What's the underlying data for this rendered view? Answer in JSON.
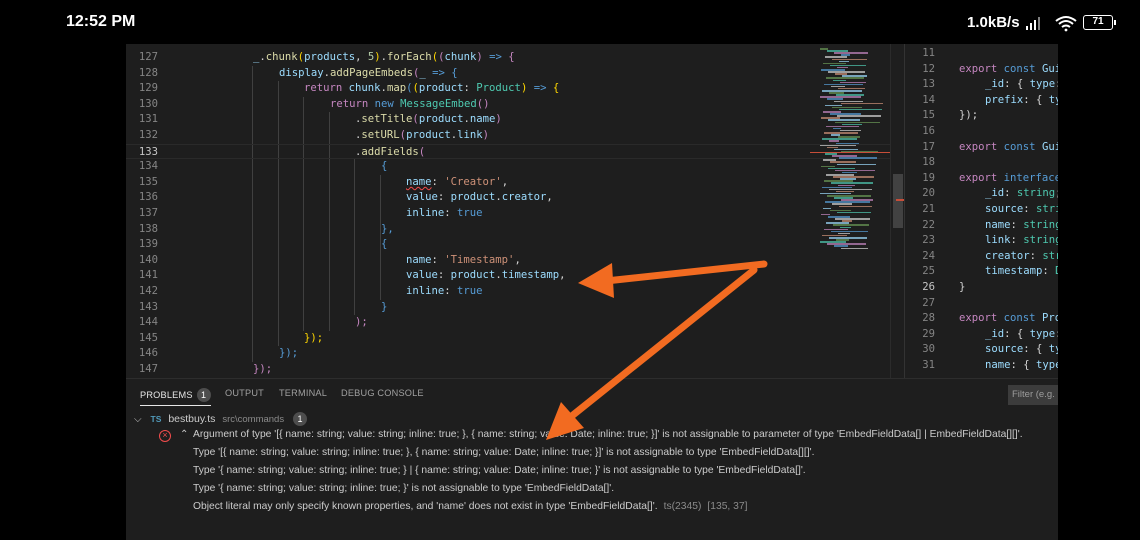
{
  "status_bar": {
    "time": "12:52 PM",
    "network_speed": "1.0kB/s",
    "battery_level": "71",
    "signal_icon": "cellular-signal-icon",
    "wifi_icon": "wifi-icon"
  },
  "editor": {
    "current_line": "133",
    "lines": [
      {
        "ln": "127",
        "tokens": [
          [
            "_",
            "t-var"
          ],
          [
            ".",
            "t-plain"
          ],
          [
            "chunk",
            "t-fn"
          ],
          [
            "(",
            "t-punct"
          ],
          [
            "products",
            "t-var"
          ],
          [
            ", ",
            "t-plain"
          ],
          [
            "5",
            "t-num"
          ],
          [
            ")",
            "t-punct"
          ],
          [
            ".",
            "t-plain"
          ],
          [
            "forEach",
            "t-fn"
          ],
          [
            "(",
            "t-punct"
          ],
          [
            "(",
            "t-kw"
          ],
          [
            "chunk",
            "t-var"
          ],
          [
            ")",
            "t-kw"
          ],
          [
            " => ",
            "t-dec"
          ],
          [
            "{",
            "t-kw"
          ]
        ]
      },
      {
        "ln": "128",
        "tokens": [
          [
            "display",
            "t-var"
          ],
          [
            ".",
            "t-plain"
          ],
          [
            "addPageEmbeds",
            "t-fn"
          ],
          [
            "(",
            "t-kw"
          ],
          [
            "_",
            "t-var"
          ],
          [
            " => ",
            "t-dec"
          ],
          [
            "{",
            "t-dec"
          ]
        ]
      },
      {
        "ln": "129",
        "tokens": [
          [
            "return ",
            "t-kw"
          ],
          [
            "chunk",
            "t-var"
          ],
          [
            ".",
            "t-plain"
          ],
          [
            "map",
            "t-fn"
          ],
          [
            "(",
            "t-dec"
          ],
          [
            "(",
            "t-punct"
          ],
          [
            "product",
            "t-var"
          ],
          [
            ": ",
            "t-plain"
          ],
          [
            "Product",
            "t-type"
          ],
          [
            ")",
            "t-punct"
          ],
          [
            " => ",
            "t-dec"
          ],
          [
            "{",
            "t-punct"
          ]
        ]
      },
      {
        "ln": "130",
        "tokens": [
          [
            "return ",
            "t-kw"
          ],
          [
            "new ",
            "t-dec"
          ],
          [
            "MessageEmbed",
            "t-type"
          ],
          [
            "()",
            "t-kw"
          ]
        ]
      },
      {
        "ln": "131",
        "tokens": [
          [
            ".",
            "t-plain"
          ],
          [
            "setTitle",
            "t-fn"
          ],
          [
            "(",
            "t-kw"
          ],
          [
            "product",
            "t-var"
          ],
          [
            ".",
            "t-plain"
          ],
          [
            "name",
            "t-var"
          ],
          [
            ")",
            "t-kw"
          ]
        ]
      },
      {
        "ln": "132",
        "tokens": [
          [
            ".",
            "t-plain"
          ],
          [
            "setURL",
            "t-fn"
          ],
          [
            "(",
            "t-kw"
          ],
          [
            "product",
            "t-var"
          ],
          [
            ".",
            "t-plain"
          ],
          [
            "link",
            "t-var"
          ],
          [
            ")",
            "t-kw"
          ]
        ]
      },
      {
        "ln": "133",
        "tokens": [
          [
            ".",
            "t-plain"
          ],
          [
            "addFields",
            "t-fn"
          ],
          [
            "(",
            "t-kw"
          ]
        ]
      },
      {
        "ln": "134",
        "tokens": [
          [
            "{",
            "t-dec"
          ]
        ]
      },
      {
        "ln": "135",
        "tokens": [
          [
            "name",
            "t-var t-err"
          ],
          [
            ": ",
            "t-plain"
          ],
          [
            "'Creator'",
            "t-str"
          ],
          [
            ",",
            "t-plain"
          ]
        ]
      },
      {
        "ln": "136",
        "tokens": [
          [
            "value",
            "t-var"
          ],
          [
            ": ",
            "t-plain"
          ],
          [
            "product",
            "t-var"
          ],
          [
            ".",
            "t-plain"
          ],
          [
            "creator",
            "t-var"
          ],
          [
            ",",
            "t-plain"
          ]
        ]
      },
      {
        "ln": "137",
        "tokens": [
          [
            "inline",
            "t-var"
          ],
          [
            ": ",
            "t-plain"
          ],
          [
            "true",
            "t-dec"
          ]
        ]
      },
      {
        "ln": "138",
        "tokens": [
          [
            "},",
            "t-dec"
          ]
        ]
      },
      {
        "ln": "139",
        "tokens": [
          [
            "{",
            "t-dec"
          ]
        ]
      },
      {
        "ln": "140",
        "tokens": [
          [
            "name",
            "t-var"
          ],
          [
            ": ",
            "t-plain"
          ],
          [
            "'Timestamp'",
            "t-str"
          ],
          [
            ",",
            "t-plain"
          ]
        ]
      },
      {
        "ln": "141",
        "tokens": [
          [
            "value",
            "t-var"
          ],
          [
            ": ",
            "t-plain"
          ],
          [
            "product",
            "t-var"
          ],
          [
            ".",
            "t-plain"
          ],
          [
            "timestamp",
            "t-var"
          ],
          [
            ",",
            "t-plain"
          ]
        ]
      },
      {
        "ln": "142",
        "tokens": [
          [
            "inline",
            "t-var"
          ],
          [
            ": ",
            "t-plain"
          ],
          [
            "true",
            "t-dec"
          ]
        ]
      },
      {
        "ln": "143",
        "tokens": [
          [
            "}",
            "t-dec"
          ]
        ]
      },
      {
        "ln": "144",
        "tokens": [
          [
            ");",
            "t-kw"
          ]
        ]
      },
      {
        "ln": "145",
        "tokens": [
          [
            "});",
            "t-punct"
          ]
        ]
      },
      {
        "ln": "146",
        "tokens": [
          [
            "});",
            "t-dec"
          ]
        ]
      },
      {
        "ln": "147",
        "tokens": [
          [
            "});",
            "t-kw"
          ]
        ]
      }
    ]
  },
  "split_editor": {
    "lines": [
      {
        "ln": "11",
        "tokens": []
      },
      {
        "ln": "12",
        "tokens": [
          [
            "export ",
            "t-kw"
          ],
          [
            "const ",
            "t-dec"
          ],
          [
            "Gui",
            "t-var"
          ]
        ]
      },
      {
        "ln": "13",
        "tokens": [
          [
            "_id",
            "t-var"
          ],
          [
            ": { ",
            "t-plain"
          ],
          [
            "type",
            "t-var"
          ],
          [
            ":",
            "t-plain"
          ]
        ]
      },
      {
        "ln": "14",
        "tokens": [
          [
            "prefix",
            "t-var"
          ],
          [
            ": { ",
            "t-plain"
          ],
          [
            "ty",
            "t-var"
          ]
        ]
      },
      {
        "ln": "15",
        "tokens": [
          [
            "});",
            "t-plain"
          ]
        ]
      },
      {
        "ln": "16",
        "tokens": []
      },
      {
        "ln": "17",
        "tokens": [
          [
            "export ",
            "t-kw"
          ],
          [
            "const ",
            "t-dec"
          ],
          [
            "Gui",
            "t-var"
          ]
        ]
      },
      {
        "ln": "18",
        "tokens": []
      },
      {
        "ln": "19",
        "tokens": [
          [
            "export ",
            "t-kw"
          ],
          [
            "interface",
            "t-dec"
          ]
        ]
      },
      {
        "ln": "20",
        "tokens": [
          [
            "_id",
            "t-var"
          ],
          [
            ": ",
            "t-plain"
          ],
          [
            "string",
            "t-type"
          ],
          [
            ";",
            "t-plain"
          ]
        ]
      },
      {
        "ln": "21",
        "tokens": [
          [
            "source",
            "t-var"
          ],
          [
            ": ",
            "t-plain"
          ],
          [
            "stri",
            "t-type"
          ]
        ]
      },
      {
        "ln": "22",
        "tokens": [
          [
            "name",
            "t-var"
          ],
          [
            ": ",
            "t-plain"
          ],
          [
            "string",
            "t-type"
          ]
        ]
      },
      {
        "ln": "23",
        "tokens": [
          [
            "link",
            "t-var"
          ],
          [
            ": ",
            "t-plain"
          ],
          [
            "string",
            "t-type"
          ]
        ]
      },
      {
        "ln": "24",
        "tokens": [
          [
            "creator",
            "t-var"
          ],
          [
            ": ",
            "t-plain"
          ],
          [
            "str",
            "t-type"
          ]
        ]
      },
      {
        "ln": "25",
        "tokens": [
          [
            "timestamp",
            "t-var"
          ],
          [
            ": ",
            "t-plain"
          ],
          [
            "D",
            "t-type"
          ]
        ]
      },
      {
        "ln": "26",
        "tokens": [
          [
            "}",
            "t-plain"
          ]
        ]
      },
      {
        "ln": "27",
        "tokens": []
      },
      {
        "ln": "28",
        "tokens": [
          [
            "export ",
            "t-kw"
          ],
          [
            "const ",
            "t-dec"
          ],
          [
            "Pro",
            "t-var"
          ]
        ]
      },
      {
        "ln": "29",
        "tokens": [
          [
            "_id",
            "t-var"
          ],
          [
            ": { ",
            "t-plain"
          ],
          [
            "type",
            "t-var"
          ],
          [
            ":",
            "t-plain"
          ]
        ]
      },
      {
        "ln": "30",
        "tokens": [
          [
            "source",
            "t-var"
          ],
          [
            ": { ",
            "t-plain"
          ],
          [
            "ty",
            "t-var"
          ]
        ]
      },
      {
        "ln": "31",
        "tokens": [
          [
            "name",
            "t-var"
          ],
          [
            ": { ",
            "t-plain"
          ],
          [
            "type",
            "t-var"
          ]
        ]
      }
    ]
  },
  "panel": {
    "tabs": [
      {
        "label": "PROBLEMS",
        "badge": "1"
      },
      {
        "label": "OUTPUT"
      },
      {
        "label": "TERMINAL"
      },
      {
        "label": "DEBUG CONSOLE"
      }
    ],
    "filter_placeholder": "Filter (e.g.",
    "file": {
      "icon_label": "TS",
      "name": "bestbuy.ts",
      "path": "src\\commands",
      "count": "1"
    },
    "messages": [
      "Argument of type '[{ name: string; value: string; inline: true; }, { name: string; value: Date; inline: true; }]' is not assignable to parameter of type 'EmbedFieldData[] | EmbedFieldData[][]'.",
      "Type '[{ name: string; value: string; inline: true; }, { name: string; value: Date; inline: true; }]' is not assignable to type 'EmbedFieldData[][]'.",
      "Type '{ name: string; value: string; inline: true; } | { name: string; value: Date; inline: true; }' is not assignable to type 'EmbedFieldData[]'.",
      "Type '{ name: string; value: string; inline: true; }' is not assignable to type 'EmbedFieldData[]'.",
      "Object literal may only specify known properties, and 'name' does not exist in type 'EmbedFieldData[]'."
    ],
    "message_code": "ts(2345)",
    "message_location": "[135, 37]"
  },
  "annotations": {
    "arrow_color": "#f26b21"
  }
}
